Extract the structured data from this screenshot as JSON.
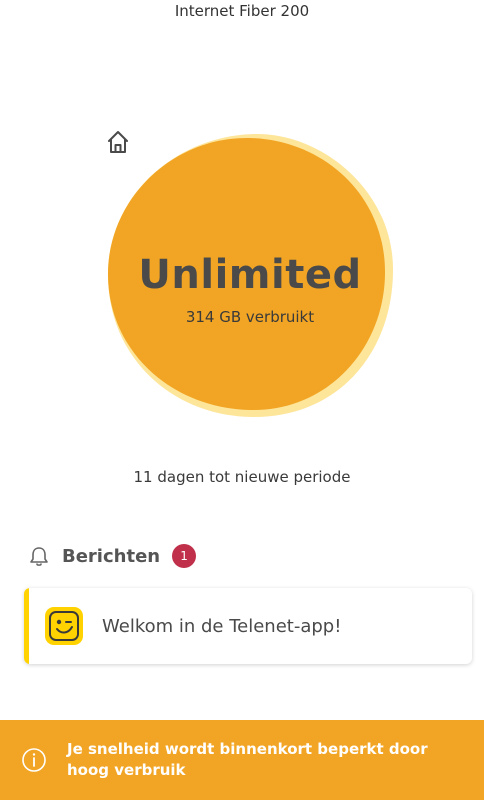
{
  "plan": {
    "title": "Internet Fiber 200"
  },
  "usage": {
    "icon": "home-icon",
    "value": "Unlimited",
    "consumed": "314 GB verbruikt"
  },
  "period": {
    "text": "11 dagen tot nieuwe periode"
  },
  "messages": {
    "icon": "bell-icon",
    "title": "Berichten",
    "count": "1",
    "items": [
      {
        "icon": "telenet-logo-icon",
        "text": "Welkom in de Telenet-app!"
      }
    ]
  },
  "banner": {
    "icon": "info-icon",
    "text": "Je snelheid wordt binnenkort beperkt door hoog verbruik"
  },
  "colors": {
    "blob": "#f2a524",
    "blob_light": "#fde59a",
    "accent": "#ffd200",
    "badge": "#c0304a",
    "banner": "#f2a524"
  }
}
